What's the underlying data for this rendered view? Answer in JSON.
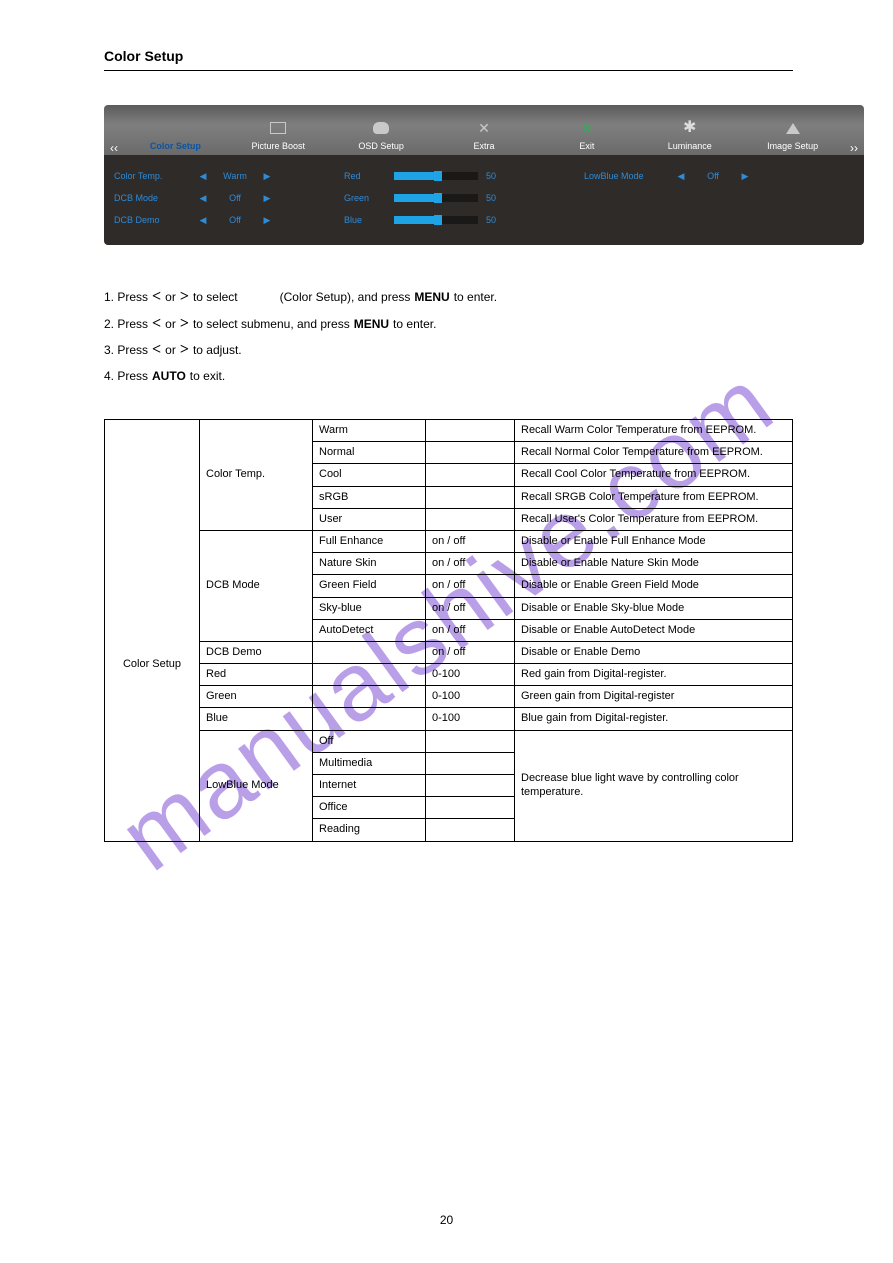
{
  "page": {
    "heading": "Color Setup",
    "number": "20"
  },
  "watermark": "manualshive.com",
  "osd_tabs": {
    "selected": "Color Setup",
    "items": [
      "Color Setup",
      "Picture Boost",
      "OSD Setup",
      "Extra",
      "Exit",
      "Luminance",
      "Image Setup"
    ]
  },
  "osd_rows": {
    "row1": {
      "label": "Color Temp.",
      "value": "Warm"
    },
    "row2": {
      "label": "DCB Mode",
      "value": "Off"
    },
    "row3": {
      "label": "DCB Demo",
      "value": "Off"
    },
    "rgb": {
      "r_label": "Red",
      "g_label": "Green",
      "b_label": "Blue",
      "num": "50"
    },
    "lowblue": {
      "label": "LowBlue Mode",
      "value": "Off"
    }
  },
  "instr": {
    "line1_a": "1.    Press",
    "line1_b": "or",
    "line1_c": "to select",
    "line1_d": "(Color Setup), and press",
    "line1_menu": "MENU",
    "line1_e": "to enter.",
    "line2_a": "2.    Press",
    "line2_b": "or",
    "line2_c": "to select submenu, and press",
    "line2_menu": "MENU",
    "line2_d": "to enter.",
    "line3_a": "3.    Press",
    "line3_b": "or",
    "line3_c": "to adjust.",
    "line4_a": "4.    Press",
    "line4_auto": "AUTO",
    "line4_b": "to exit."
  },
  "table": {
    "category_icon_caption": "Color Setup",
    "rows": {
      "ct": {
        "label": "Color Temp.",
        "r1": {
          "a": "Warm",
          "b": "",
          "c": "Recall Warm Color Temperature from EEPROM."
        },
        "r2": {
          "a": "Normal",
          "b": "",
          "c": "Recall Normal Color Temperature from EEPROM."
        },
        "r3": {
          "a": "Cool",
          "b": "",
          "c": "Recall Cool Color Temperature from EEPROM."
        },
        "r4": {
          "a": "sRGB",
          "b": "",
          "c": "Recall SRGB Color Temperature from EEPROM."
        },
        "r5": {
          "a": "User",
          "b": "",
          "c": "Recall User's Color Temperature from EEPROM."
        }
      },
      "dcb": {
        "label": "DCB Mode",
        "r1": {
          "a": "Full Enhance",
          "b": "on / off",
          "c": "Disable or Enable Full Enhance Mode"
        },
        "r2": {
          "a": "Nature Skin",
          "b": "on / off",
          "c": "Disable or Enable Nature Skin Mode"
        },
        "r3": {
          "a": "Green Field",
          "b": "on / off",
          "c": "Disable or Enable Green Field Mode"
        },
        "r4": {
          "a": "Sky-blue",
          "b": "on / off",
          "c": "Disable or Enable Sky-blue Mode"
        },
        "r5": {
          "a": "AutoDetect",
          "b": "on / off",
          "c": "Disable or Enable AutoDetect Mode"
        }
      },
      "demo": {
        "label": "DCB Demo",
        "a": "",
        "b": "on / off",
        "c": "Disable or Enable Demo"
      },
      "red": {
        "label": "Red",
        "a": "",
        "b": "0-100",
        "c": "Red gain from Digital-register."
      },
      "green": {
        "label": "Green",
        "a": "",
        "b": "0-100",
        "c": "Green gain from Digital-register"
      },
      "blue": {
        "label": "Blue",
        "a": "",
        "b": "0-100",
        "c": "Blue gain from Digital-register."
      },
      "lowblue": {
        "label": "LowBlue Mode",
        "r1": {
          "a": "Off",
          "b": ""
        },
        "r2": {
          "a": "Multimedia",
          "b": ""
        },
        "r3": {
          "a": "Internet",
          "b": ""
        },
        "r4": {
          "a": "Office",
          "b": ""
        },
        "r5": {
          "a": "Reading",
          "b": ""
        },
        "desc": "Decrease blue light wave by controlling color temperature."
      }
    }
  }
}
